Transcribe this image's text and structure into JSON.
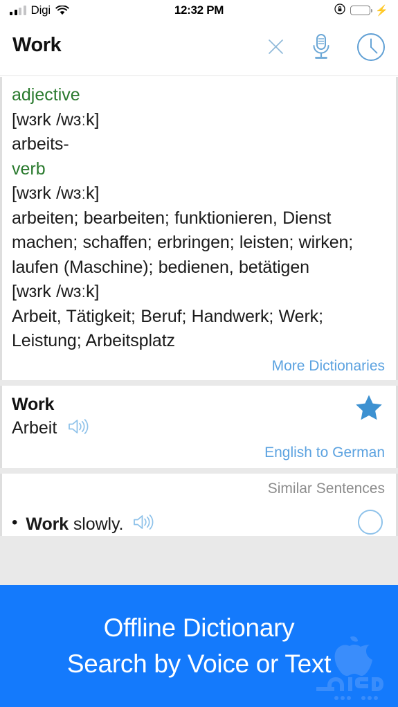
{
  "status_bar": {
    "carrier": "Digi",
    "time": "12:32 PM",
    "signal_icon": "signal-bars-icon",
    "wifi_icon": "wifi-icon",
    "rotation_lock_icon": "rotation-lock-icon",
    "battery_icon": "battery-icon",
    "charging_icon": "lightning-bolt-icon",
    "battery_color": "#35d34a"
  },
  "header": {
    "title": "Work",
    "close_icon": "close-x-icon",
    "mic_icon": "microphone-icon",
    "history_icon": "clock-history-icon",
    "icon_color": "#7db4e0"
  },
  "definition_card": {
    "entries": [
      {
        "pos": "adjective",
        "phonetic": "[wɜrk /wɜːk]",
        "meanings": "arbeits-"
      },
      {
        "pos": "verb",
        "phonetic": "[wɜrk /wɜːk]",
        "meanings": "arbeiten; bearbeiten; funktionieren, Dienst machen; schaffen; erbringen; leisten; wirken; laufen (Maschine); bedienen, betätigen"
      },
      {
        "pos": "",
        "phonetic": "[wɜrk /wɜːk]",
        "meanings": "Arbeit, Tätigkeit; Beruf; Handwerk; Werk; Leistung; Arbeitsplatz"
      }
    ],
    "more_link": "More Dictionaries",
    "pos_color": "#2a7a2e",
    "link_color": "#5ba2e0"
  },
  "translation_card": {
    "word": "Work",
    "meaning": "Arbeit",
    "speaker_icon": "speaker-audio-icon",
    "star_icon": "star-filled-icon",
    "language_pair": "English to German",
    "star_color": "#3d91d1"
  },
  "sentences_card": {
    "header": "Similar Sentences",
    "items": [
      {
        "bullet": "•",
        "bold_part": "Work",
        "rest": " slowly.",
        "speaker_icon": "speaker-audio-icon",
        "favorite_icon": "circle-outline-icon"
      }
    ]
  },
  "banner": {
    "line1": "Offline Dictionary",
    "line2": "Search by Voice or Text",
    "background_color": "#147afc",
    "text_color": "#ffffff",
    "watermark_icon": "apple-sibapp-watermark-icon"
  }
}
